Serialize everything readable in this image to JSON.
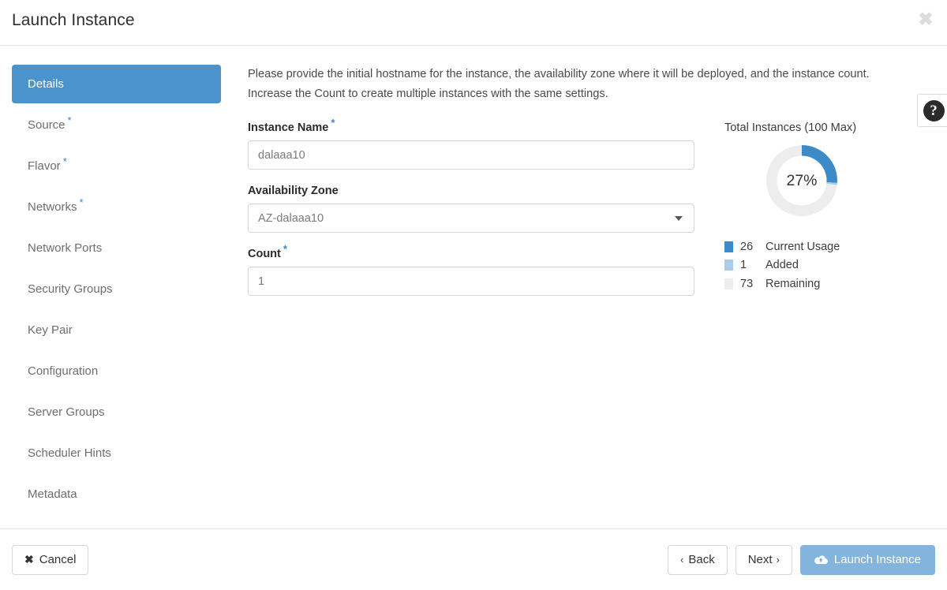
{
  "header": {
    "title": "Launch Instance",
    "close_label": "✖"
  },
  "sidebar": {
    "items": [
      {
        "label": "Details",
        "required": false,
        "active": true
      },
      {
        "label": "Source",
        "required": true,
        "active": false
      },
      {
        "label": "Flavor",
        "required": true,
        "active": false
      },
      {
        "label": "Networks",
        "required": true,
        "active": false
      },
      {
        "label": "Network Ports",
        "required": false,
        "active": false
      },
      {
        "label": "Security Groups",
        "required": false,
        "active": false
      },
      {
        "label": "Key Pair",
        "required": false,
        "active": false
      },
      {
        "label": "Configuration",
        "required": false,
        "active": false
      },
      {
        "label": "Server Groups",
        "required": false,
        "active": false
      },
      {
        "label": "Scheduler Hints",
        "required": false,
        "active": false
      },
      {
        "label": "Metadata",
        "required": false,
        "active": false
      }
    ]
  },
  "main": {
    "intro": "Please provide the initial hostname for the instance, the availability zone where it will be deployed, and the instance count. Increase the Count to create multiple instances with the same settings.",
    "help_icon_label": "?",
    "fields": {
      "instance_name": {
        "label": "Instance Name",
        "required_marker": "*",
        "value": "dalaaa10",
        "placeholder": ""
      },
      "availability_zone": {
        "label": "Availability Zone",
        "required_marker": "",
        "value": "AZ-dalaaa10"
      },
      "count": {
        "label": "Count",
        "required_marker": "*",
        "value": "1",
        "placeholder": ""
      }
    }
  },
  "chart_data": {
    "type": "pie",
    "title": "Total Instances (100 Max)",
    "center_label": "27%",
    "max": 100,
    "categories": [
      "Current Usage",
      "Added",
      "Remaining"
    ],
    "values": [
      26,
      1,
      73
    ],
    "colors": [
      "#3d8ac9",
      "#a8cde9",
      "#ededed"
    ],
    "legend": [
      {
        "value": "26",
        "label": "Current Usage",
        "color": "#3d8ac9"
      },
      {
        "value": "1",
        "label": "Added",
        "color": "#a8cde9"
      },
      {
        "value": "73",
        "label": "Remaining",
        "color": "#ededed"
      }
    ],
    "legend_position": "bottom-left",
    "start_angle_deg": 0,
    "grid": false
  },
  "footer": {
    "cancel": {
      "icon": "✖",
      "label": "Cancel"
    },
    "back": {
      "chevron": "‹",
      "label": "Back"
    },
    "next": {
      "label": "Next",
      "chevron": "›"
    },
    "launch": {
      "label": "Launch Instance",
      "icon": "cloud-upload-icon"
    }
  },
  "colors": {
    "accent": "#4b93cd",
    "primary_button": "#83b4de",
    "required_star": "#3c87c4",
    "usage": "#3d8ac9",
    "added": "#a8cde9",
    "remaining": "#ededed"
  }
}
